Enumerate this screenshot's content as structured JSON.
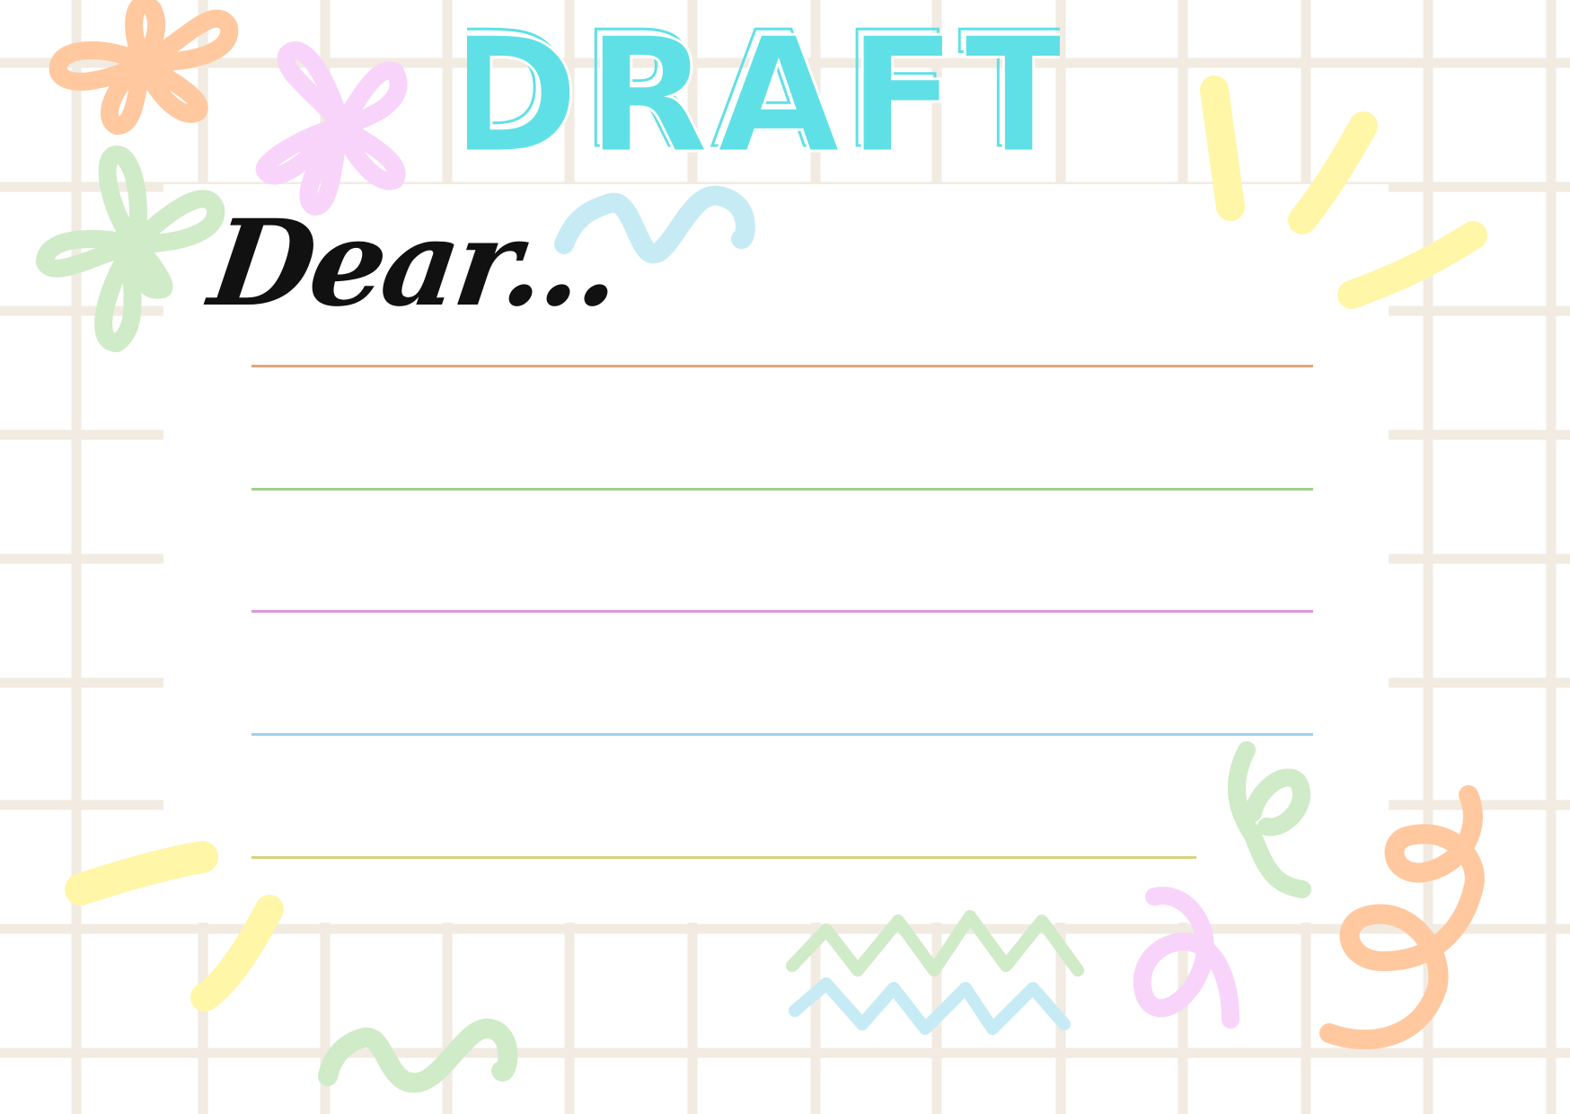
{
  "title": "DRAFT",
  "greeting": "Dear...",
  "colors": {
    "grid": "#f1ebe2",
    "title_fill": "#5fe0e6",
    "orange": "#ffc89f",
    "pink": "#f8d4fb",
    "green": "#cfebc7",
    "yellow": "#fff6a8",
    "blue": "#c6ebf5"
  },
  "writing_lines": [
    {
      "color": "#e3a77a"
    },
    {
      "color": "#9fd28b"
    },
    {
      "color": "#da9ad8"
    },
    {
      "color": "#9ed0ec"
    },
    {
      "color": "#d6d37f"
    }
  ]
}
